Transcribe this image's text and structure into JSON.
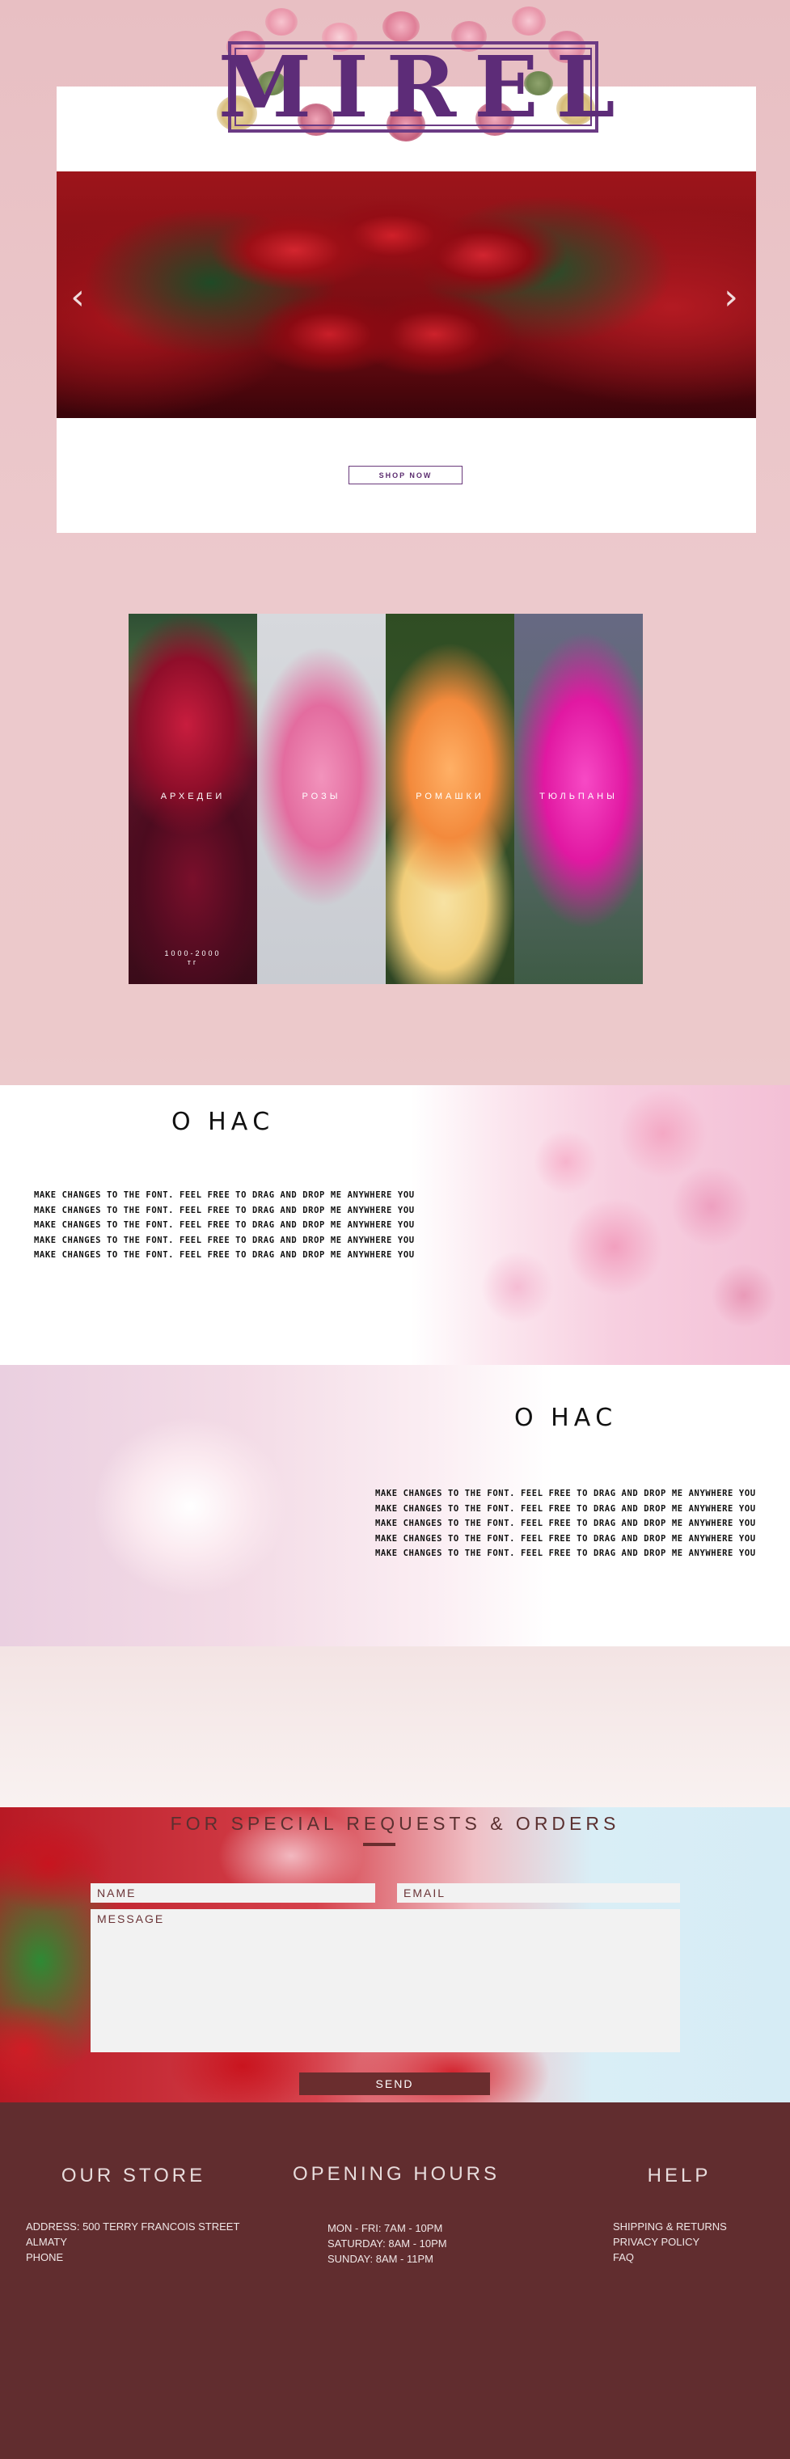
{
  "brand": {
    "logo_text": "MIREL"
  },
  "hero": {
    "shop_now_label": "SHOP NOW",
    "prev_icon": "chevron-left-icon",
    "next_icon": "chevron-right-icon"
  },
  "categories": [
    {
      "label": "АРХЕДЕИ",
      "price_line1": "1000-2000",
      "price_line2": "тг"
    },
    {
      "label": "РОЗЫ",
      "price_line1": "",
      "price_line2": ""
    },
    {
      "label": "РОМАШКИ",
      "price_line1": "",
      "price_line2": ""
    },
    {
      "label": "ТЮЛЬПАНЫ",
      "price_line1": "",
      "price_line2": ""
    }
  ],
  "about1": {
    "title": "О НАС",
    "lines": [
      "MAKE CHANGES TO THE FONT. FEEL FREE TO DRAG AND DROP ME ANYWHERE YOU",
      "MAKE CHANGES TO THE FONT. FEEL FREE TO DRAG AND DROP ME ANYWHERE YOU",
      "MAKE CHANGES TO THE FONT. FEEL FREE TO DRAG AND DROP ME ANYWHERE YOU",
      "MAKE CHANGES TO THE FONT. FEEL FREE TO DRAG AND DROP ME ANYWHERE YOU",
      "MAKE CHANGES TO THE FONT. FEEL FREE TO DRAG AND DROP ME ANYWHERE YOU"
    ]
  },
  "about2": {
    "title": "О НАС",
    "lines": [
      "MAKE CHANGES TO THE FONT. FEEL FREE TO DRAG AND DROP ME ANYWHERE YOU",
      "MAKE CHANGES TO THE FONT. FEEL FREE TO DRAG AND DROP ME ANYWHERE YOU",
      "MAKE CHANGES TO THE FONT. FEEL FREE TO DRAG AND DROP ME ANYWHERE YOU",
      "MAKE CHANGES TO THE FONT. FEEL FREE TO DRAG AND DROP ME ANYWHERE YOU",
      "MAKE CHANGES TO THE FONT. FEEL FREE TO DRAG AND DROP ME ANYWHERE YOU"
    ]
  },
  "contact": {
    "title": "FOR SPECIAL REQUESTS & ORDERS",
    "name_placeholder": "NAME",
    "email_placeholder": "EMAIL",
    "message_placeholder": "MESSAGE",
    "send_label": "SEND"
  },
  "footer": {
    "store": {
      "heading": "OUR STORE",
      "lines": [
        "ADDRESS: 500 TERRY FRANCOIS STREET",
        "ALMATY",
        "PHONE"
      ]
    },
    "hours": {
      "heading": "OPENING HOURS",
      "lines": [
        "MON - FRI: 7AM - 10PM",
        "SATURDAY: 8AM - 10PM",
        "SUNDAY: 8AM - 11PM"
      ]
    },
    "help": {
      "heading": "HELP",
      "links": [
        "SHIPPING & RETURNS",
        "PRIVACY POLICY",
        "FAQ"
      ]
    }
  },
  "colors": {
    "brand_purple": "#5d2c78",
    "accent_maroon": "#6a2d2e",
    "footer_bg": "#612d2f",
    "page_pink": "#e8bfc3"
  }
}
